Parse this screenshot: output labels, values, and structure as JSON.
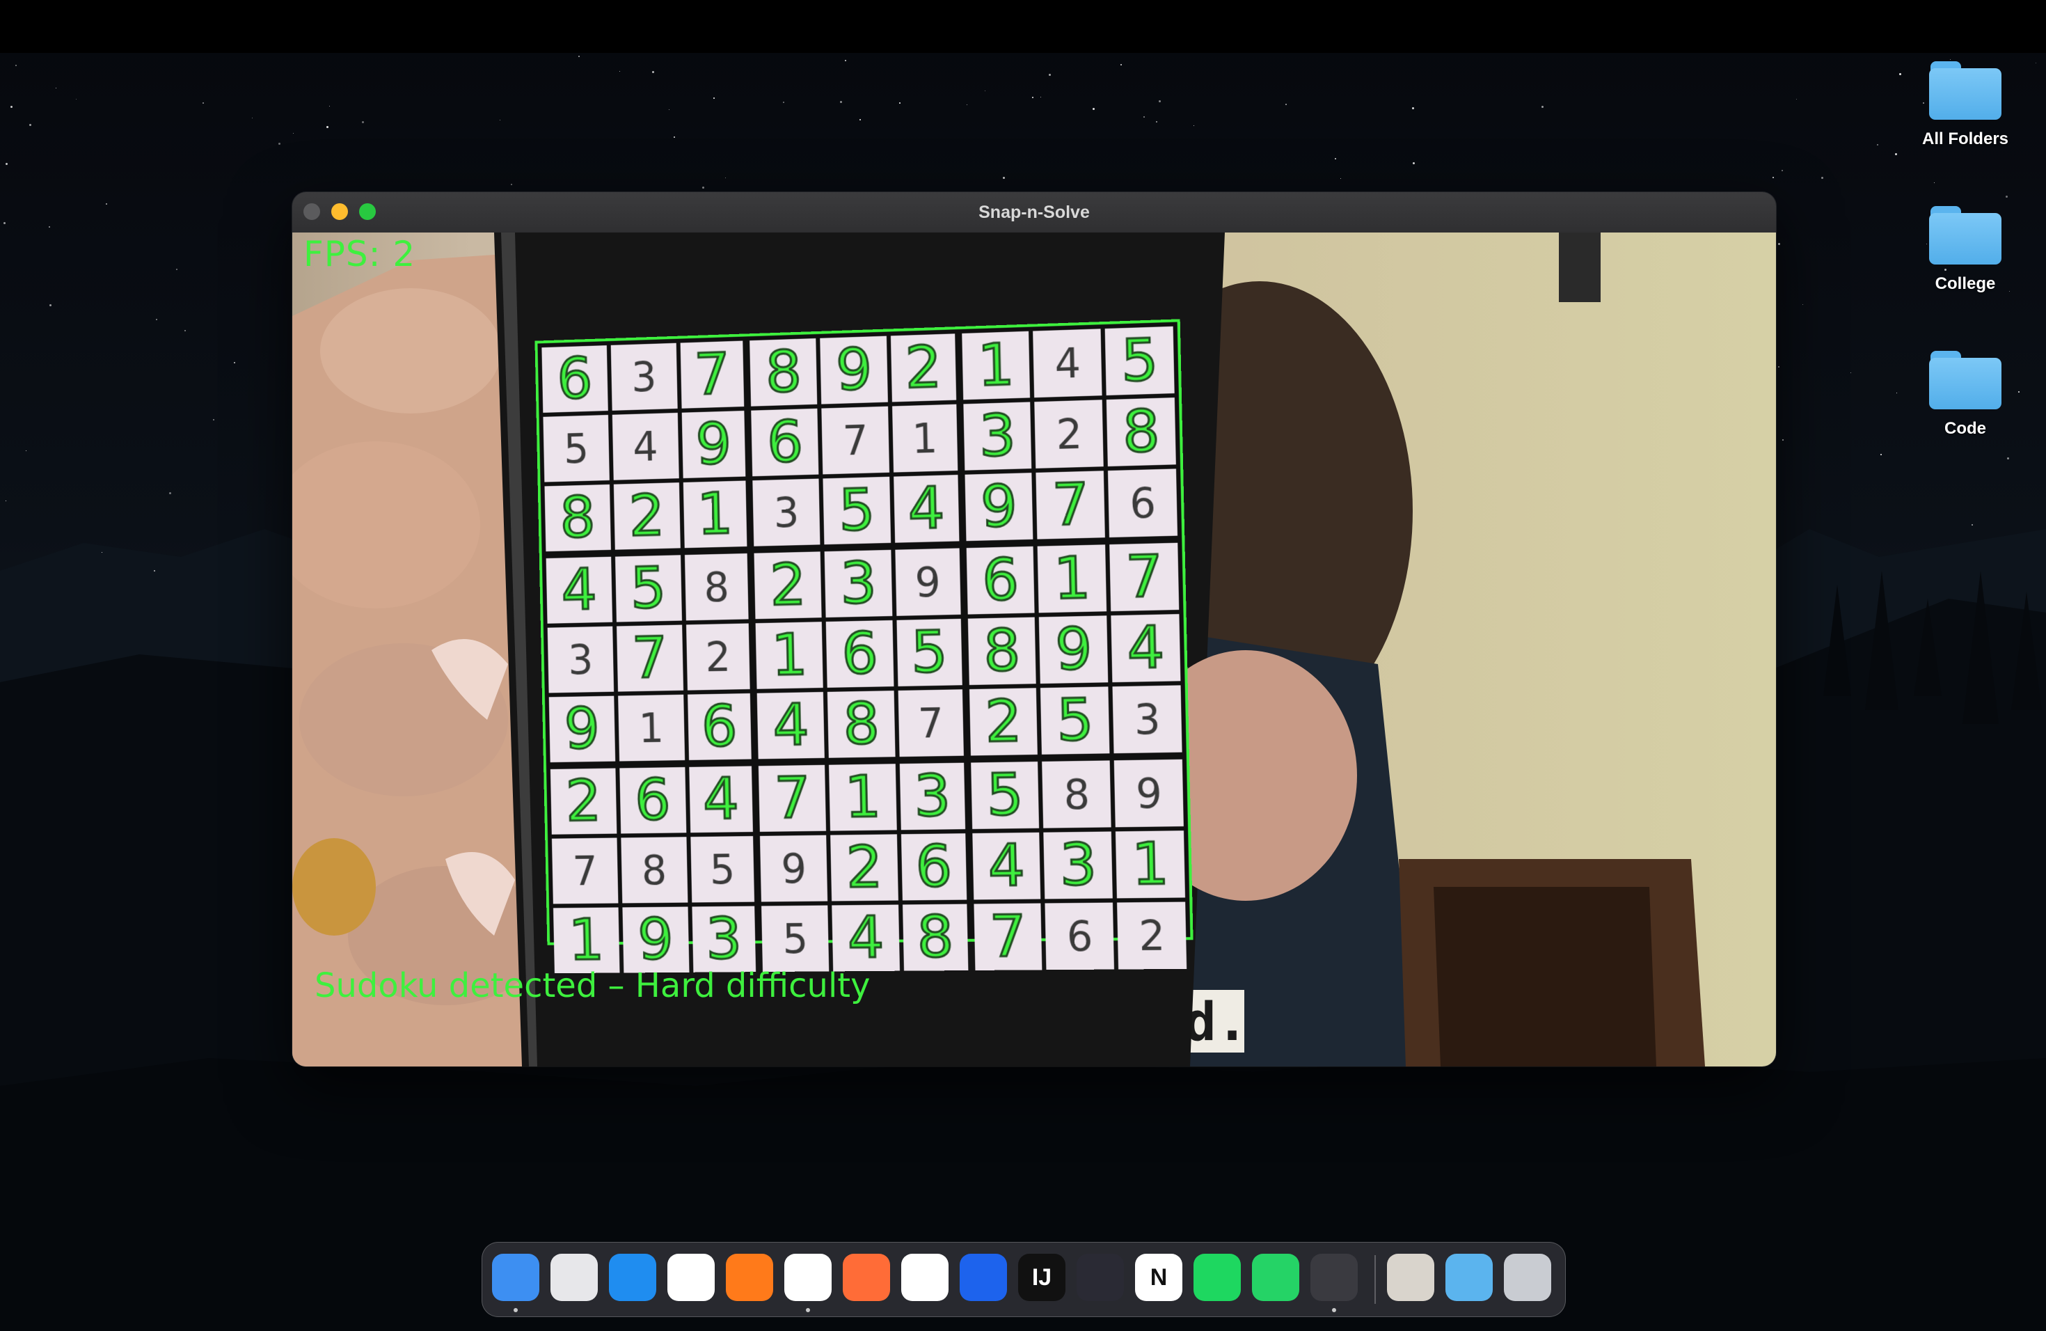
{
  "app": {
    "title": "Snap-n-Solve"
  },
  "overlay": {
    "fps_text": "FPS: 2",
    "status_text": "Sudoku detected – Hard difficulty",
    "color": "#3ef03e"
  },
  "sudoku": {
    "rows": [
      [
        "6",
        "3",
        "7",
        "8",
        "9",
        "2",
        "1",
        "4",
        "5"
      ],
      [
        "5",
        "4",
        "9",
        "6",
        "7",
        "1",
        "3",
        "2",
        "8"
      ],
      [
        "8",
        "2",
        "1",
        "3",
        "5",
        "4",
        "9",
        "7",
        "6"
      ],
      [
        "4",
        "5",
        "8",
        "2",
        "3",
        "9",
        "6",
        "1",
        "7"
      ],
      [
        "3",
        "7",
        "2",
        "1",
        "6",
        "5",
        "8",
        "9",
        "4"
      ],
      [
        "9",
        "1",
        "6",
        "4",
        "8",
        "7",
        "2",
        "5",
        "3"
      ],
      [
        "2",
        "6",
        "4",
        "7",
        "1",
        "3",
        "5",
        "8",
        "9"
      ],
      [
        "7",
        "8",
        "5",
        "9",
        "2",
        "6",
        "4",
        "3",
        "1"
      ],
      [
        "1",
        "9",
        "3",
        "5",
        "4",
        "8",
        "7",
        "6",
        "2"
      ]
    ],
    "solved_mask": [
      [
        1,
        0,
        1,
        1,
        1,
        1,
        1,
        0,
        1
      ],
      [
        0,
        0,
        1,
        1,
        0,
        0,
        1,
        0,
        1
      ],
      [
        1,
        1,
        1,
        0,
        1,
        1,
        1,
        1,
        0
      ],
      [
        1,
        1,
        0,
        1,
        1,
        0,
        1,
        1,
        1
      ],
      [
        0,
        1,
        0,
        1,
        1,
        1,
        1,
        1,
        1
      ],
      [
        1,
        0,
        1,
        1,
        1,
        0,
        1,
        1,
        0
      ],
      [
        1,
        1,
        1,
        1,
        1,
        1,
        1,
        0,
        0
      ],
      [
        0,
        0,
        0,
        0,
        1,
        1,
        1,
        1,
        1
      ],
      [
        1,
        1,
        1,
        0,
        1,
        1,
        1,
        0,
        0
      ]
    ]
  },
  "shirt_text": "d.",
  "desktop": {
    "folders": [
      {
        "label": "All Folders",
        "icon": "folder-icon"
      },
      {
        "label": "College",
        "icon": "folder-icon"
      },
      {
        "label": "Code",
        "icon": "folder-icon"
      }
    ]
  },
  "dock": {
    "apps": [
      {
        "name": "finder-icon",
        "glyph": "",
        "bg": "#3d8ff2",
        "running": true
      },
      {
        "name": "launchpad-icon",
        "glyph": "",
        "bg": "#e7e7ea",
        "running": false
      },
      {
        "name": "safari-icon",
        "glyph": "",
        "bg": "#1f8df0",
        "running": false
      },
      {
        "name": "chrome-icon",
        "glyph": "",
        "bg": "#ffffff",
        "running": false
      },
      {
        "name": "firefox-icon",
        "glyph": "",
        "bg": "#ff7a1a",
        "running": false
      },
      {
        "name": "vscode-icon",
        "glyph": "",
        "bg": "#ffffff",
        "running": true
      },
      {
        "name": "postman-icon",
        "glyph": "",
        "bg": "#ff6c37",
        "running": false
      },
      {
        "name": "mongodb-icon",
        "glyph": "",
        "bg": "#ffffff",
        "running": false
      },
      {
        "name": "docker-icon",
        "glyph": "",
        "bg": "#1d63ed",
        "running": false
      },
      {
        "name": "intellij-icon",
        "glyph": "IJ",
        "bg": "#111111",
        "running": false
      },
      {
        "name": "obsidian-icon",
        "glyph": "",
        "bg": "#2a2a34",
        "running": false
      },
      {
        "name": "notion-icon",
        "glyph": "N",
        "bg": "#ffffff",
        "running": false
      },
      {
        "name": "spotify-icon",
        "glyph": "",
        "bg": "#1ed760",
        "running": false
      },
      {
        "name": "whatsapp-icon",
        "glyph": "",
        "bg": "#25d366",
        "running": false
      },
      {
        "name": "python-launcher-icon",
        "glyph": "",
        "bg": "#3a3a40",
        "running": true
      }
    ],
    "right": [
      {
        "name": "downloads-stack-icon",
        "glyph": "",
        "bg": "#d9d4cc"
      },
      {
        "name": "folder-stack-icon",
        "glyph": "",
        "bg": "#5bb4ee"
      },
      {
        "name": "trash-icon",
        "glyph": "",
        "bg": "#c9ccd2"
      }
    ]
  }
}
